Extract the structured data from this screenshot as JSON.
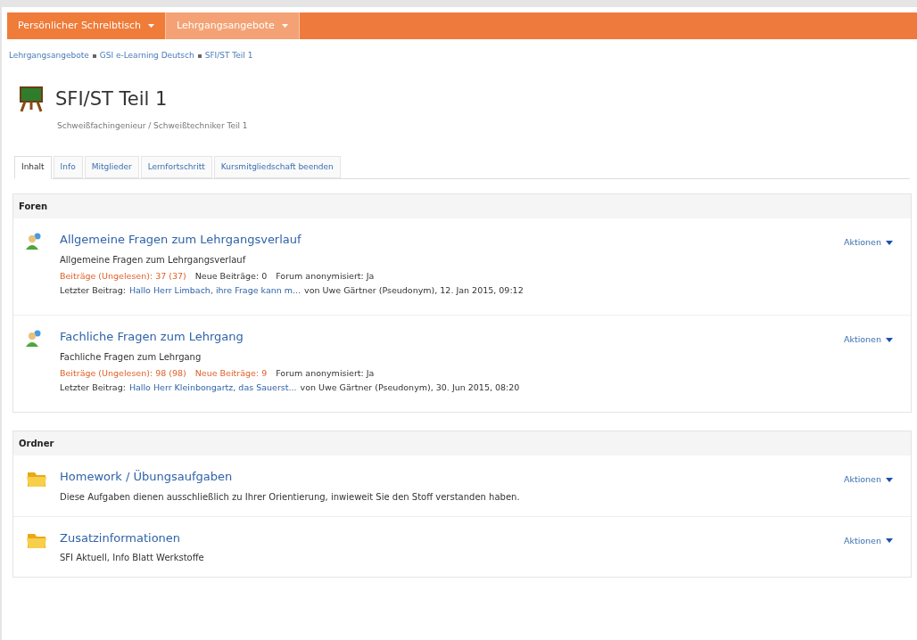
{
  "nav": [
    {
      "label": "Persönlicher Schreibtisch",
      "selected": false
    },
    {
      "label": "Lehrgangsangebote",
      "selected": true
    }
  ],
  "breadcrumb": [
    "Lehrgangsangebote",
    "GSI e-Learning Deutsch",
    "SFI/ST Teil 1"
  ],
  "course": {
    "title": "SFI/ST Teil 1",
    "subtitle": "Schweißfachingenieur / Schweißtechniker Teil 1"
  },
  "tabs": [
    {
      "label": "Inhalt",
      "selected": true
    },
    {
      "label": "Info",
      "selected": false
    },
    {
      "label": "Mitglieder",
      "selected": false
    },
    {
      "label": "Lernfortschritt",
      "selected": false
    },
    {
      "label": "Kursmitgliedschaft beenden",
      "selected": false
    }
  ],
  "sections": [
    {
      "title": "Foren",
      "items": [
        {
          "kind": "forum",
          "title": "Allgemeine Fragen zum Lehrgangsverlauf",
          "description": "Allgemeine Fragen zum Lehrgangsverlauf",
          "actions": "Aktionen",
          "stats": [
            {
              "text": "Beiträge (Ungelesen): 37 (37)",
              "highlight": true
            },
            {
              "text": "Neue Beiträge: 0",
              "highlight": false
            },
            {
              "text": "Forum anonymisiert: Ja",
              "highlight": false
            }
          ],
          "last_post": {
            "label": "Letzter Beitrag:",
            "link": "Hallo Herr Limbach, ihre Frage kann m...",
            "info": "von Uwe Gärtner (Pseudonym), 12. Jan 2015, 09:12"
          }
        },
        {
          "kind": "forum",
          "title": "Fachliche Fragen zum Lehrgang",
          "description": "Fachliche Fragen zum Lehrgang",
          "actions": "Aktionen",
          "stats": [
            {
              "text": "Beiträge (Ungelesen): 98 (98)",
              "highlight": true
            },
            {
              "text": "Neue Beiträge: 9",
              "highlight": true
            },
            {
              "text": "Forum anonymisiert: Ja",
              "highlight": false
            }
          ],
          "last_post": {
            "label": "Letzter Beitrag:",
            "link": "Hallo Herr Kleinbongartz, das Sauerst...",
            "info": "von Uwe Gärtner (Pseudonym), 30. Jun 2015, 08:20"
          }
        }
      ]
    },
    {
      "title": "Ordner",
      "items": [
        {
          "kind": "folder",
          "title": "Homework / Übungsaufgaben",
          "description": "Diese Aufgaben dienen ausschließlich zu Ihrer Orientierung, inwieweit Sie den Stoff verstanden haben.",
          "actions": "Aktionen"
        },
        {
          "kind": "folder",
          "title": "Zusatzinformationen",
          "description": "SFI Aktuell, Info Blatt Werkstoffe",
          "actions": "Aktionen"
        }
      ]
    }
  ]
}
